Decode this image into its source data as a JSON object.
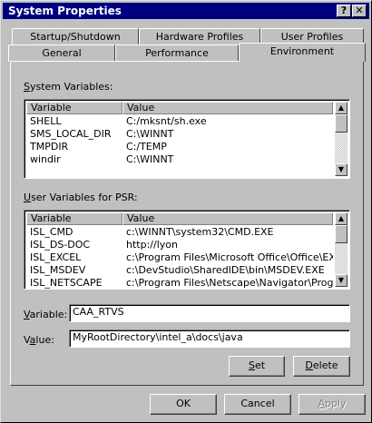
{
  "window": {
    "title": "System Properties",
    "help_label": "?",
    "close_label": "✕"
  },
  "tabs": {
    "row_back": [
      {
        "label": "Startup/Shutdown"
      },
      {
        "label": "Hardware Profiles"
      },
      {
        "label": "User Profiles"
      }
    ],
    "row_front": [
      {
        "label": "General"
      },
      {
        "label": "Performance"
      },
      {
        "label": "Environment"
      }
    ],
    "active": "Environment"
  },
  "system_vars": {
    "label_mn": "S",
    "label_rest": "ystem Variables:",
    "columns": {
      "variable": "Variable",
      "value": "Value"
    },
    "rows": [
      {
        "variable": "SHELL",
        "value": "C:/mksnt/sh.exe"
      },
      {
        "variable": "SMS_LOCAL_DIR",
        "value": "C:\\WINNT"
      },
      {
        "variable": "TMPDIR",
        "value": "C:/TEMP"
      },
      {
        "variable": "windir",
        "value": "C:\\WINNT"
      }
    ]
  },
  "user_vars": {
    "label_mn": "U",
    "label_rest": "ser Variables for PSR:",
    "columns": {
      "variable": "Variable",
      "value": "Value"
    },
    "rows": [
      {
        "variable": "ISL_CMD",
        "value": "c:\\WINNT\\system32\\CMD.EXE"
      },
      {
        "variable": "ISL_DS-DOC",
        "value": "http://lyon"
      },
      {
        "variable": "ISL_EXCEL",
        "value": "c:\\Program Files\\Microsoft Office\\Office\\EX..."
      },
      {
        "variable": "ISL_MSDEV",
        "value": "c:\\DevStudio\\SharedIDE\\bin\\MSDEV.EXE"
      },
      {
        "variable": "ISL_NETSCAPE",
        "value": "c:\\Program Files\\Netscape\\Navigator\\Progr..."
      }
    ]
  },
  "variable_field": {
    "label_mn": "V",
    "label_rest": "ariable:",
    "value": "CAA_RTVS"
  },
  "value_field": {
    "label_pre": "V",
    "label_mn": "a",
    "label_rest": "lue:",
    "value": "MyRootDirectory\\intel_a\\docs\\java"
  },
  "buttons": {
    "set": {
      "label_mn": "S",
      "label_rest": "et"
    },
    "delete": {
      "label_mn": "D",
      "label_rest": "elete"
    },
    "ok": "OK",
    "cancel": "Cancel",
    "apply": {
      "label_mn": "A",
      "label_rest": "pply"
    }
  }
}
